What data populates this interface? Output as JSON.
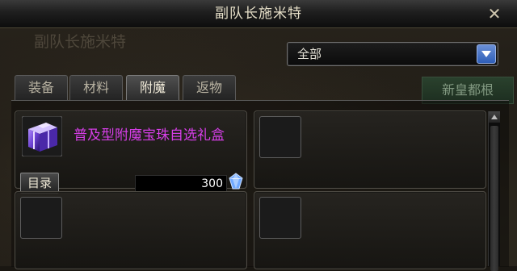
{
  "window": {
    "title": "副队长施米特",
    "close_glyph": "✕"
  },
  "background": {
    "npc_label": "副队长施米特",
    "sign_text": "新皇都根"
  },
  "filter": {
    "selected": "全部"
  },
  "tabs": [
    {
      "label": "装备",
      "active": false
    },
    {
      "label": "材料",
      "active": false
    },
    {
      "label": "附魔",
      "active": true
    },
    {
      "label": "返物",
      "active": false
    }
  ],
  "items": [
    {
      "name": "普及型附魔宝珠自选礼盒",
      "catalog_label": "目录",
      "price": "300",
      "currency_icon": "crystal-gem-icon",
      "icon": "gift-box-icon",
      "name_color": "#d63ee8"
    }
  ],
  "colors": {
    "accent": "#4f7fd0",
    "item_name": "#d63ee8"
  }
}
